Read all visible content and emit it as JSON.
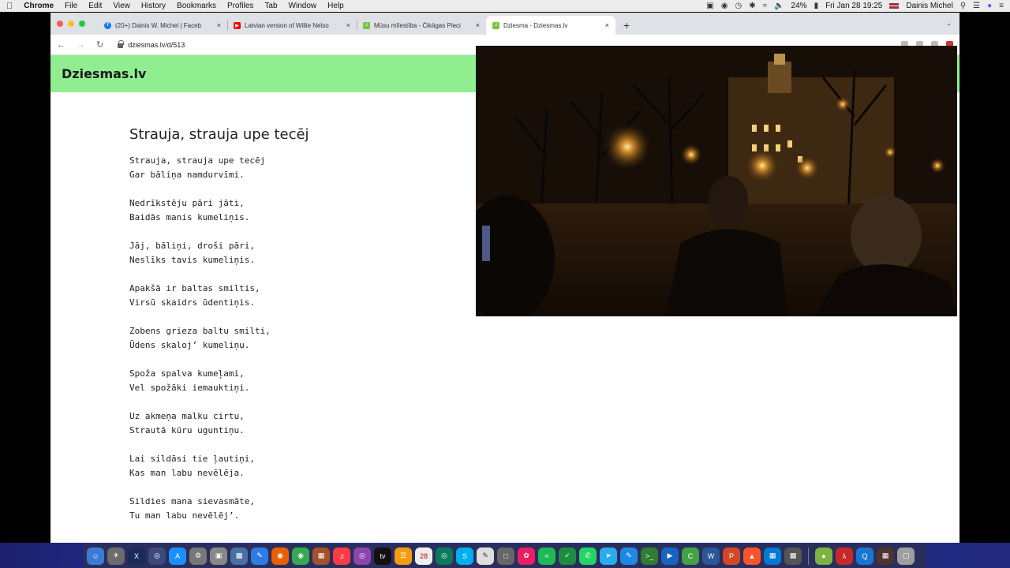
{
  "menubar": {
    "app_name": "Chrome",
    "items": [
      "File",
      "Edit",
      "View",
      "History",
      "Bookmarks",
      "Profiles",
      "Tab",
      "Window",
      "Help"
    ],
    "battery": "24%",
    "datetime": "Fri Jan 28  19:25",
    "user": "Dainis Michel"
  },
  "browser": {
    "tabs": [
      {
        "title": "(20+) Dainis W. Michel | Faceb",
        "favicon": "facebook-icon",
        "color": "#1877f2"
      },
      {
        "title": "Latvian version of Willie Nelso",
        "favicon": "youtube-icon",
        "color": "#ff0000"
      },
      {
        "title": "Mūsu mīlestība - Čikāgas Pieci",
        "favicon": "dziesmas-icon",
        "color": "#7cc242"
      },
      {
        "title": "Dziesma - Dziesmas.lv",
        "favicon": "dziesmas-icon",
        "color": "#7cc242"
      }
    ],
    "url": "dziesmas.lv/d/513"
  },
  "site": {
    "logo": "Dziesmas.lv",
    "header_color": "#90ee90"
  },
  "song": {
    "title": "Strauja, strauja upe tecēj",
    "stanzas": [
      [
        "Strauja, strauja upe tecēj",
        "Gar bāliņa namdurvīmi."
      ],
      [
        "Nedrīkstēju pāri jāti,",
        "Baidās manis kumeliņis."
      ],
      [
        "Jāj, bāliņi, droši pāri,",
        "Neslīks tavis kumeliņis."
      ],
      [
        "Apakšā ir baltas smiltis,",
        "Virsū skaidrs ūdentiņis."
      ],
      [
        "Zobens grieza baltu smilti,",
        "Ūdens skaloj’ kumeliņu."
      ],
      [
        "Spoža spalva kumeļami,",
        "Vel spožāki iemauktiņi."
      ],
      [
        "Uz akmeņa malku cirtu,",
        "Strautā kūru uguntiņu."
      ],
      [
        "Lai sildāsi tie ļautiņi,",
        "Kas man labu nevēlēja."
      ],
      [
        "Sildies mana sievasmāte,",
        "Tu man labu nevēlēj’."
      ]
    ]
  }
}
